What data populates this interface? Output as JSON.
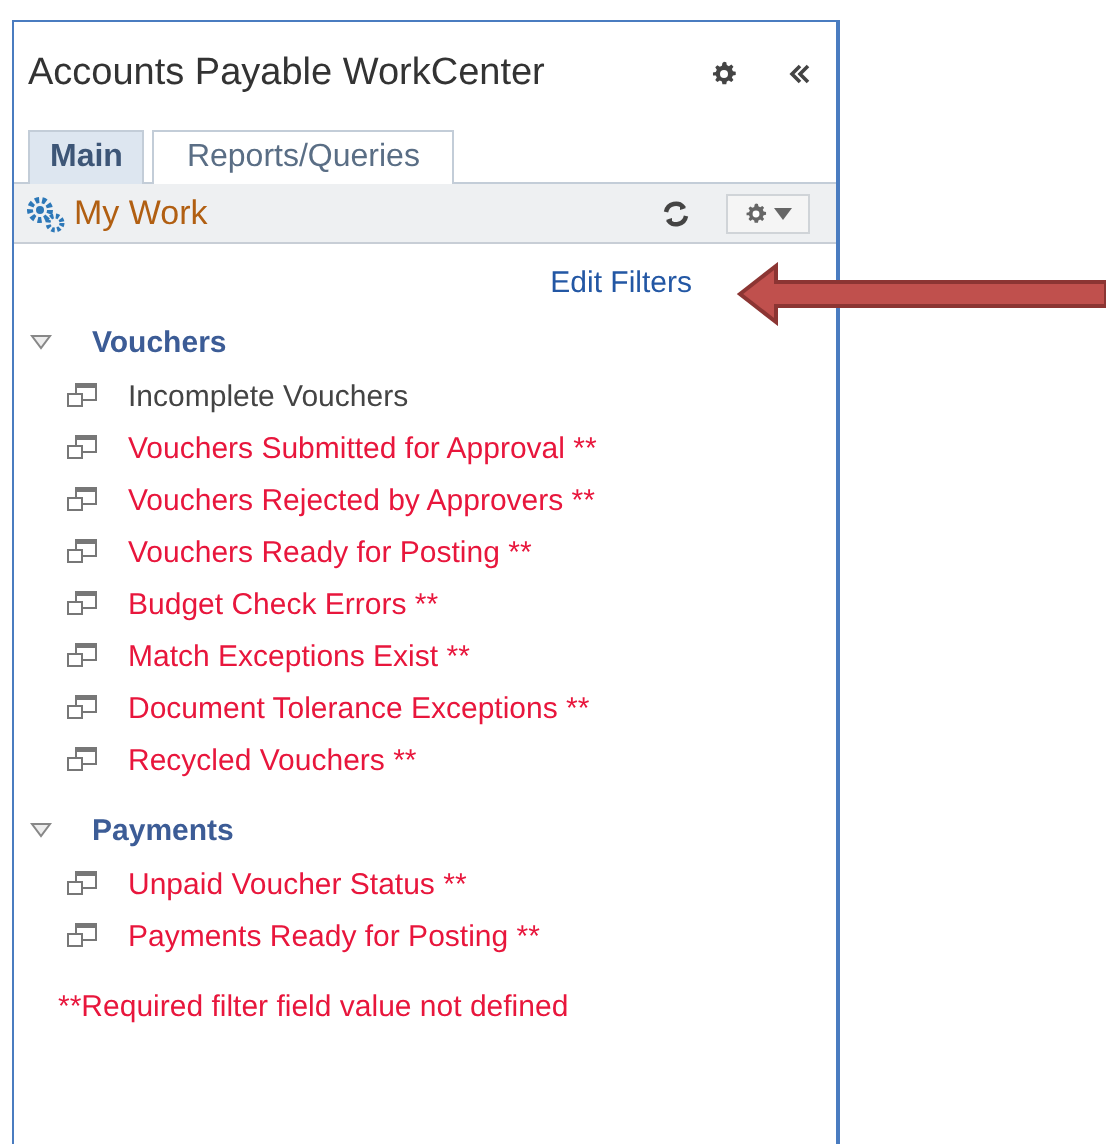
{
  "window": {
    "title": "Accounts Payable WorkCenter"
  },
  "tabs": [
    {
      "label": "Main",
      "selected": true
    },
    {
      "label": "Reports/Queries",
      "selected": false
    }
  ],
  "pagelet": {
    "title": "My Work"
  },
  "edit_filters": "Edit Filters",
  "sections": [
    {
      "title": "Vouchers",
      "expanded": true,
      "items": [
        {
          "label": "Incomplete Vouchers",
          "filter_missing": false
        },
        {
          "label": "Vouchers Submitted for Approval **",
          "filter_missing": true
        },
        {
          "label": "Vouchers Rejected by Approvers **",
          "filter_missing": true
        },
        {
          "label": "Vouchers Ready for Posting **",
          "filter_missing": true
        },
        {
          "label": "Budget Check Errors **",
          "filter_missing": true
        },
        {
          "label": "Match Exceptions Exist **",
          "filter_missing": true
        },
        {
          "label": "Document Tolerance Exceptions **",
          "filter_missing": true
        },
        {
          "label": "Recycled Vouchers **",
          "filter_missing": true
        }
      ]
    },
    {
      "title": "Payments",
      "expanded": true,
      "items": [
        {
          "label": "Unpaid Voucher Status **",
          "filter_missing": true
        },
        {
          "label": "Payments Ready for Posting **",
          "filter_missing": true
        }
      ]
    }
  ],
  "footnote": "**Required filter field value not defined"
}
